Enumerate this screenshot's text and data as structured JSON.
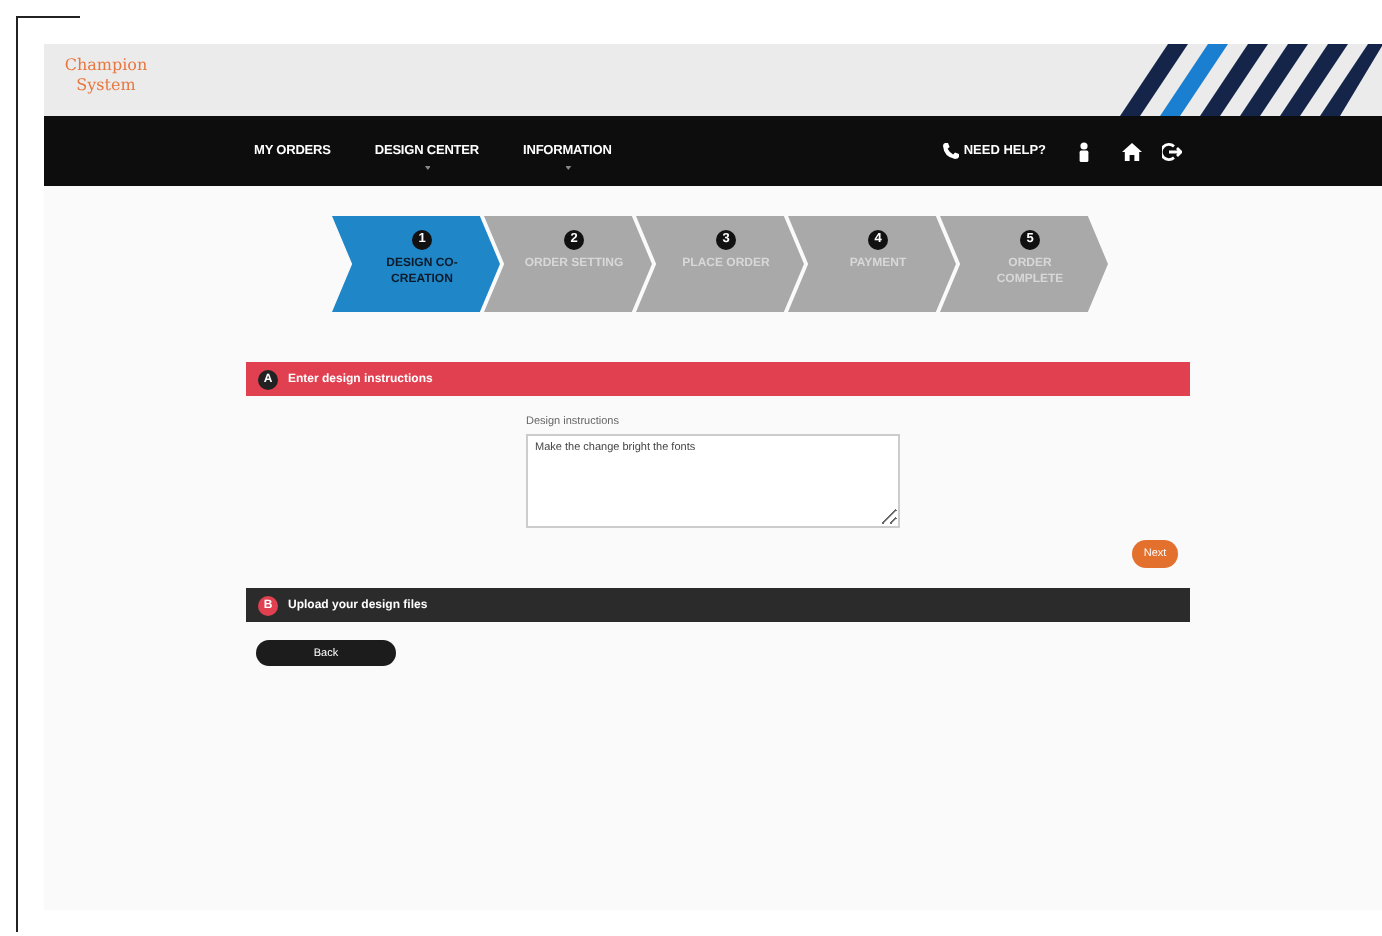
{
  "header": {
    "logo": "Champion System"
  },
  "nav": {
    "items": [
      {
        "label": "MY ORDERS",
        "has_menu": false
      },
      {
        "label": "DESIGN CENTER",
        "has_menu": true
      },
      {
        "label": "INFORMATION",
        "has_menu": true
      }
    ],
    "help": "NEED HELP?"
  },
  "steps": [
    {
      "number": "1",
      "label": "DESIGN CO-CREATION",
      "selected": true
    },
    {
      "number": "2",
      "label": "ORDER SETTING",
      "selected": false
    },
    {
      "number": "3",
      "label": "PLACE ORDER",
      "selected": false
    },
    {
      "number": "4",
      "label": "PAYMENT",
      "selected": false
    },
    {
      "number": "5",
      "label": "ORDER COMPLETE",
      "selected": false
    }
  ],
  "sections": [
    {
      "letter": "A",
      "title": "Enter design instructions",
      "active": true,
      "field_label": "Design instructions",
      "value": "Make the change bright the fonts",
      "next_button": "Next"
    },
    {
      "letter": "B",
      "title": "Upload your design files",
      "active": false
    }
  ],
  "back_button": "Back"
}
